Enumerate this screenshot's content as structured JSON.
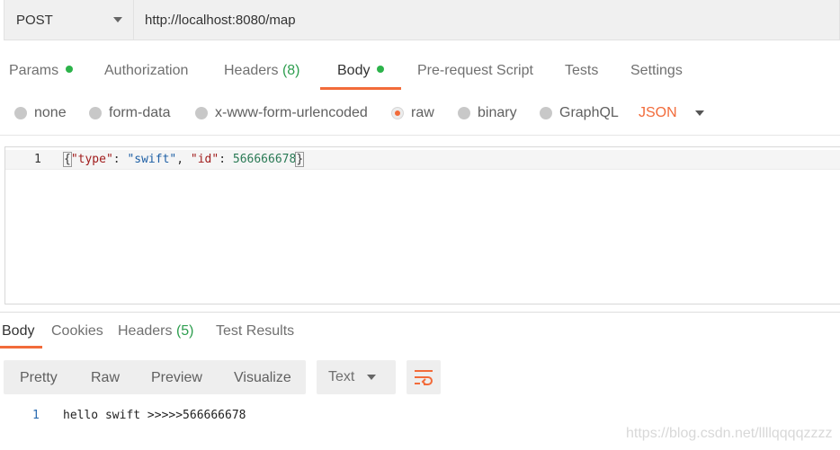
{
  "request": {
    "method": "POST",
    "url": "http://localhost:8080/map"
  },
  "request_tabs": {
    "params": "Params",
    "authorization": "Authorization",
    "headers": "Headers",
    "headers_count": "(8)",
    "body": "Body",
    "pre_request": "Pre-request Script",
    "tests": "Tests",
    "settings": "Settings"
  },
  "body_types": {
    "none": "none",
    "form_data": "form-data",
    "urlencoded": "x-www-form-urlencoded",
    "raw": "raw",
    "binary": "binary",
    "graphql": "GraphQL",
    "selected": "raw",
    "language": "JSON"
  },
  "editor": {
    "line_number": "1",
    "open_brace": "{",
    "key_type": "\"type\"",
    "colon1": ": ",
    "val_type": "\"swift\"",
    "comma": ", ",
    "key_id": "\"id\"",
    "colon2": ": ",
    "val_id": "566666678",
    "close_brace": "}"
  },
  "response_tabs": {
    "body": "Body",
    "cookies": "Cookies",
    "headers": "Headers",
    "headers_count": "(5)",
    "test_results": "Test Results"
  },
  "response_view": {
    "pretty": "Pretty",
    "raw": "Raw",
    "preview": "Preview",
    "visualize": "Visualize",
    "format": "Text"
  },
  "response_body": {
    "line_number": "1",
    "text": "hello swift >>>>>566666678"
  },
  "watermark": "https://blog.csdn.net/llllqqqqzzzz",
  "colors": {
    "accent": "#f26b3a",
    "active_dot": "#2cb34a",
    "count_green": "#2e9e4f"
  },
  "icons": {
    "wrap": "wrap-lines-icon"
  }
}
